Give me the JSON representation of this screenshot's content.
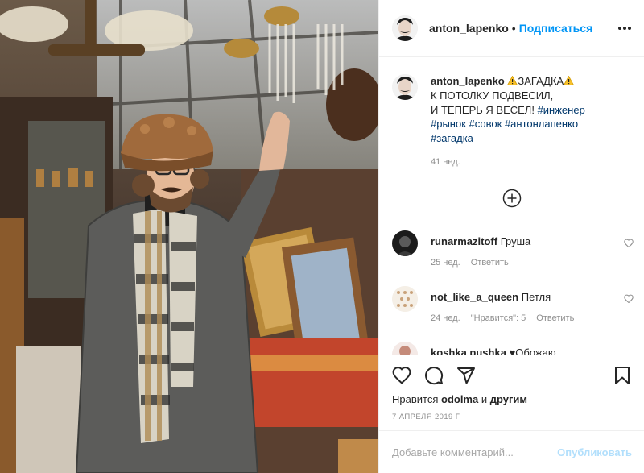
{
  "post": {
    "username": "anton_lapenko",
    "separator": "•",
    "follow_label": "Подписаться",
    "more_icon": "more-horizontal-icon",
    "photo_alt": "Man in fur hat and plaid scarf reaching towards chandeliers at a flea market"
  },
  "caption": {
    "username": "anton_lapenko",
    "line1": "ЗАГАДКА",
    "line2": "К ПОТОЛКУ ПОДВЕСИЛ,",
    "line3": "И ТЕПЕРЬ Я ВЕСЕЛ! ",
    "tags": [
      "#инженер",
      "#рынок",
      "#совок",
      "#антонлапенко",
      "#загадка"
    ],
    "time": "41 нед."
  },
  "comments": [
    {
      "username": "runarmazitoff",
      "text": "Груша",
      "time": "25 нед.",
      "reply": "Ответить",
      "likes": ""
    },
    {
      "username": "not_like_a_queen",
      "text": "Петля",
      "time": "24 нед.",
      "likes": "\"Нравится\": 5",
      "reply": "Ответить"
    },
    {
      "username": "koshka.pushka",
      "text": "♥Обожаю"
    }
  ],
  "actions": {
    "likes_prefix": "Нравится",
    "likes_user": "odolma",
    "likes_and": "и",
    "likes_others": "другим",
    "date": "7 АПРЕЛЯ 2019 Г."
  },
  "add_comment": {
    "placeholder": "Добавьте комментарий...",
    "publish_label": "Опубликовать"
  },
  "colors": {
    "accent": "#0095f6",
    "publish_disabled": "#b2dffc",
    "hashtag": "#00376b",
    "muted": "#8e8e8e"
  }
}
